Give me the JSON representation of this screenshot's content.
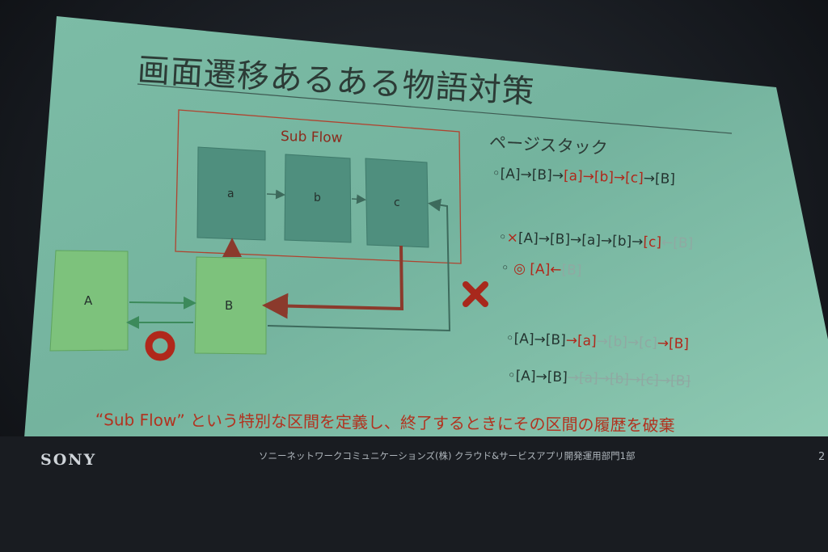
{
  "slide": {
    "title": "画面遷移あるある物語対策",
    "subflow_label": "Sub Flow",
    "boxes": {
      "a": "a",
      "b": "b",
      "c": "c",
      "A": "A",
      "B_main": "B"
    },
    "stack_title": "ページスタック",
    "stack_lines": [
      {
        "parts": [
          "◦[A]→[B]→",
          "[a]→[b]→[c]",
          "→[B]"
        ]
      },
      {
        "parts": [
          "◦",
          "×",
          "[A]→[B]→[a]→[b]→",
          "[c]",
          "←[B]"
        ]
      },
      {
        "parts": [
          "◦ ",
          "◎ [A]←",
          "[B]"
        ]
      },
      {
        "parts": [
          "◦[A]→[B]",
          "→[a]",
          "→[b]→[c]",
          "→[B]"
        ]
      },
      {
        "parts": [
          "◦[A]→[B]",
          "→[a]→[b]→[c]→[B]"
        ]
      }
    ],
    "caption": "“Sub Flow” という特別な区間を定義し、終了するときにその区間の履歴を破棄",
    "colors": {
      "slide_bg": "#74b39e",
      "accent_red": "#b0281b",
      "box_fill": "#4f8f7e",
      "box_green": "#7dc27c"
    },
    "icons": {
      "ok_mark": "circle-icon",
      "ng_mark": "cross-icon"
    }
  },
  "footer": {
    "brand": "SONY",
    "text": "ソニーネットワークコミュニケーションズ(株) クラウド&サービスアプリ開発運用部門1部",
    "page_num": "2"
  }
}
